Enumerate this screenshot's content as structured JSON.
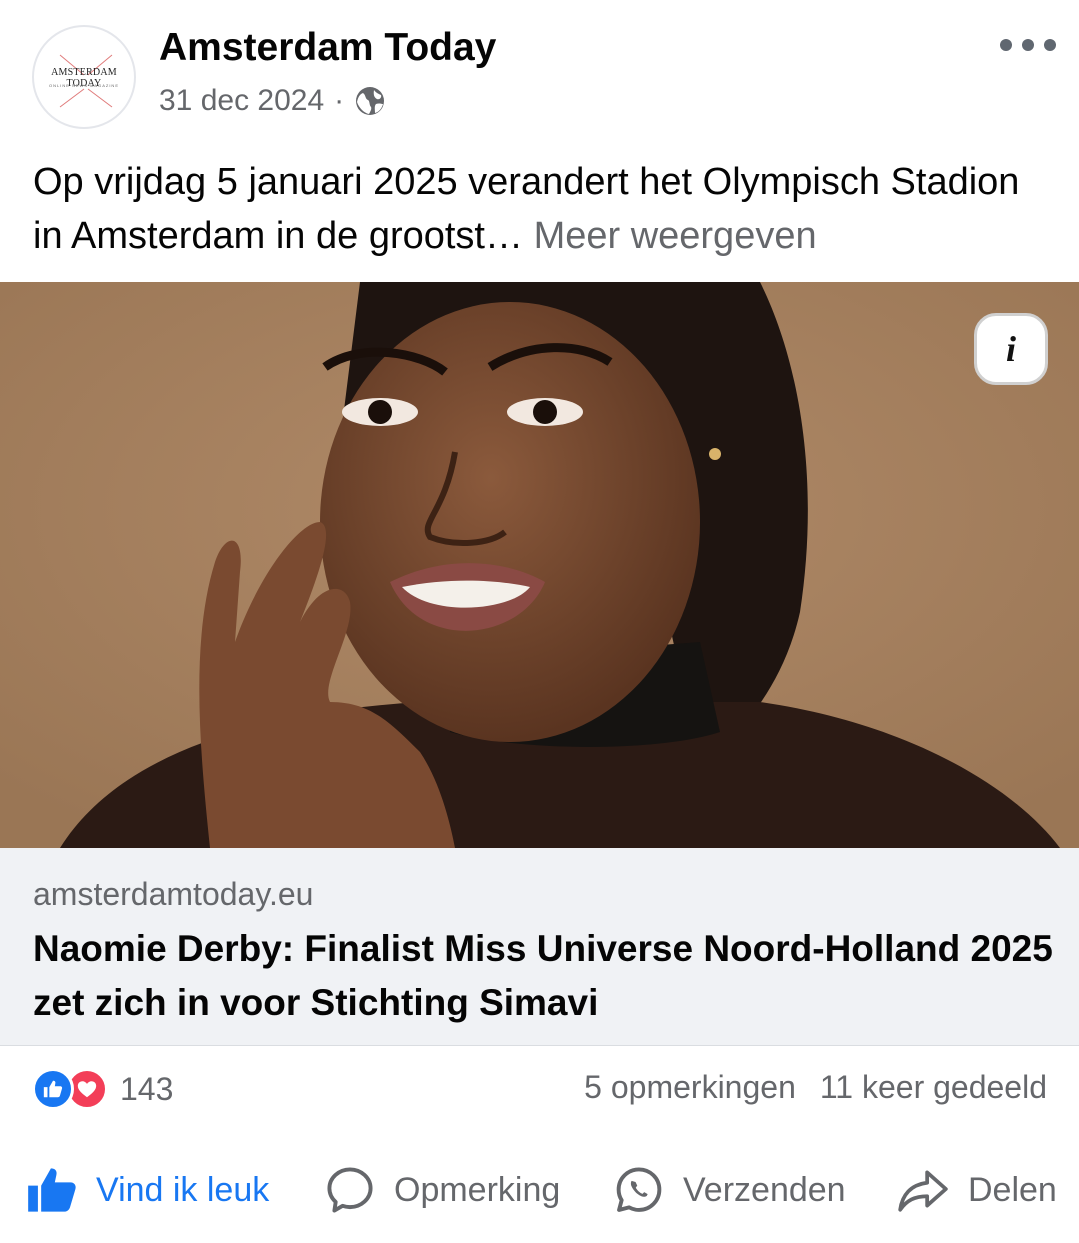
{
  "post": {
    "page_name": "Amsterdam Today",
    "avatar_text": "AMSTERDAM TODAY",
    "avatar_subtext": "ONLINE NEWS MAGAZINE",
    "date": "31 dec 2024",
    "separator": "·",
    "visibility_icon": "globe-icon",
    "menu_icon": "more-options-icon",
    "text_line": "Op vrijdag 5 januari 2025 verandert het Olympisch Stadion in Amsterdam in de grootst…",
    "see_more": "Meer weergeven"
  },
  "link_preview": {
    "info_label": "i",
    "domain": "amsterdamtoday.eu",
    "title": "Naomie Derby: Finalist Miss Universe Noord-Holland 2025 zet zich in voor Stichting Simavi"
  },
  "engagement": {
    "reaction_icons": [
      "like-reaction-icon",
      "love-reaction-icon"
    ],
    "reaction_count": "143",
    "comments": "5 opmerkingen",
    "shares": "11 keer gedeeld"
  },
  "actions": {
    "like": "Vind ik leuk",
    "comment": "Opmerking",
    "send": "Verzenden",
    "share": "Delen"
  },
  "colors": {
    "accent": "#1877f2",
    "secondary_text": "#65676b",
    "love": "#f33e58",
    "card_bg": "#f0f2f5"
  }
}
